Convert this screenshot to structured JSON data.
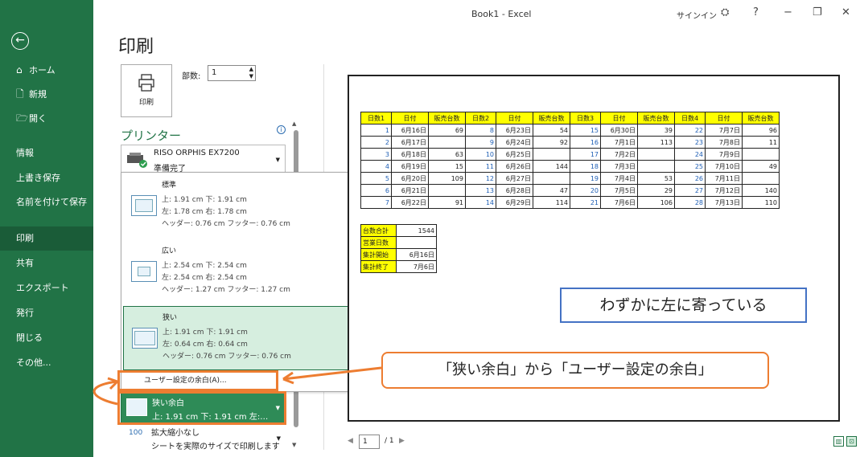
{
  "window": {
    "title": "Book1  -  Excel",
    "signin": "サインイン",
    "controls": [
      "?",
      "−",
      "❐",
      "✕"
    ]
  },
  "sidebar": {
    "back_icon": "back-arrow-icon",
    "items": [
      {
        "label": "ホーム",
        "icon": "⌂"
      },
      {
        "label": "新規",
        "icon": "🗋"
      },
      {
        "label": "開く",
        "icon": "🗁"
      },
      {
        "label": "情報"
      },
      {
        "label": "上書き保存"
      },
      {
        "label": "名前を付けて保存"
      },
      {
        "label": "印刷"
      },
      {
        "label": "共有"
      },
      {
        "label": "エクスポート"
      },
      {
        "label": "発行"
      },
      {
        "label": "閉じる"
      },
      {
        "label": "その他..."
      }
    ]
  },
  "print": {
    "heading": "印刷",
    "print_button": "印刷",
    "copies_label": "部数:",
    "copies_value": "1",
    "printer_heading": "プリンター",
    "printer_name": "RISO ORPHIS EX7200",
    "printer_status": "準備完了"
  },
  "margin_menu": {
    "options": [
      {
        "title": "標準",
        "row1": "上:    1.91 cm  下:    1.91 cm",
        "row2": "左:    1.78 cm  右:    1.78 cm",
        "row3": "ヘッダー:       0.76 cm フッター:       0.76 cm"
      },
      {
        "title": "広い",
        "row1": "上:    2.54 cm  下:    2.54 cm",
        "row2": "左:    2.54 cm  右:    2.54 cm",
        "row3": "ヘッダー:       1.27 cm フッター:       1.27 cm"
      },
      {
        "title": "狭い",
        "row1": "上:    1.91 cm  下:    1.91 cm",
        "row2": "左:    0.64 cm  右:    0.64 cm",
        "row3": "ヘッダー:       0.76 cm フッター:       0.76 cm"
      }
    ],
    "custom_item": "ユーザー設定の余白(A)..."
  },
  "settings": {
    "margin_title": "狭い余白",
    "margin_detail": "上: 1.91 cm 下: 1.91 cm 左:…",
    "scale_title": "拡大縮小なし",
    "scale_detail": "シートを実際のサイズで印刷します",
    "scale_icon_text": "100"
  },
  "sheet": {
    "headers": [
      "日数1",
      "日付",
      "販売台数",
      "日数2",
      "日付",
      "販売台数",
      "日数3",
      "日付",
      "販売台数",
      "日数4",
      "日付",
      "販売台数"
    ],
    "rows": [
      [
        "1",
        "6月16日",
        "69",
        "8",
        "6月23日",
        "54",
        "15",
        "6月30日",
        "39",
        "22",
        "7月7日",
        "96"
      ],
      [
        "2",
        "6月17日",
        "",
        "9",
        "6月24日",
        "92",
        "16",
        "7月1日",
        "113",
        "23",
        "7月8日",
        "11"
      ],
      [
        "3",
        "6月18日",
        "63",
        "10",
        "6月25日",
        "",
        "17",
        "7月2日",
        "",
        "24",
        "7月9日",
        ""
      ],
      [
        "4",
        "6月19日",
        "15",
        "11",
        "6月26日",
        "144",
        "18",
        "7月3日",
        "",
        "25",
        "7月10日",
        "49"
      ],
      [
        "5",
        "6月20日",
        "109",
        "12",
        "6月27日",
        "",
        "19",
        "7月4日",
        "53",
        "26",
        "7月11日",
        ""
      ],
      [
        "6",
        "6月21日",
        "",
        "13",
        "6月28日",
        "47",
        "20",
        "7月5日",
        "29",
        "27",
        "7月12日",
        "140"
      ],
      [
        "7",
        "6月22日",
        "91",
        "14",
        "6月29日",
        "114",
        "21",
        "7月6日",
        "106",
        "28",
        "7月13日",
        "110"
      ]
    ],
    "summary": [
      [
        "台数合計",
        "1544"
      ],
      [
        "営業日数",
        ""
      ],
      [
        "集計開始",
        "6月16日"
      ],
      [
        "集計終了",
        "7月6日"
      ]
    ]
  },
  "annotations": {
    "blue_callout": "わずかに左に寄っている",
    "orange_callout": "「狭い余白」から「ユーザー設定の余白」"
  },
  "pager": {
    "current": "1",
    "total": "/ 1"
  },
  "colors": {
    "brand": "#217346",
    "highlight": "#ffff00",
    "callout_orange": "#ed7d31",
    "callout_blue": "#4472c4"
  }
}
